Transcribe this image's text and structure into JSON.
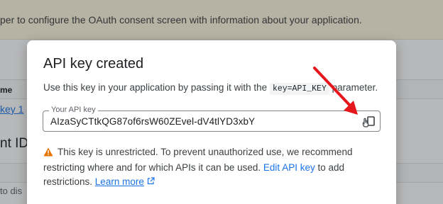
{
  "background": {
    "banner_text": "per to configure the OAuth consent screen with information about your application.",
    "column_header": "me",
    "link_text": "key 1",
    "section_heading": "nt IDs",
    "bottom_text": "to dis"
  },
  "dialog": {
    "title": "API key created",
    "body_prefix": "Use this key in your application by passing it with the",
    "body_code": "key=API_KEY",
    "body_suffix": "parameter.",
    "field_label": "Your API key",
    "api_key_value": "AIzaSyCTtkQG87of6rsW60ZEvel-dV4tlYD3xbY",
    "copy_icon": "copy-icon",
    "warning_icon": "warning-icon",
    "warning_text_1": "This key is unrestricted. To prevent unauthorized use, we recommend restricting where and for which APIs it can be used.",
    "warning_link": "Edit API key",
    "warning_text_2": "to add restrictions.",
    "learn_more": "Learn more",
    "external_icon": "external-link-icon"
  },
  "colors": {
    "accent": "#1a73e8",
    "warning": "#e37400",
    "annotation": "#e5161c",
    "banner": "#fef7e0"
  }
}
